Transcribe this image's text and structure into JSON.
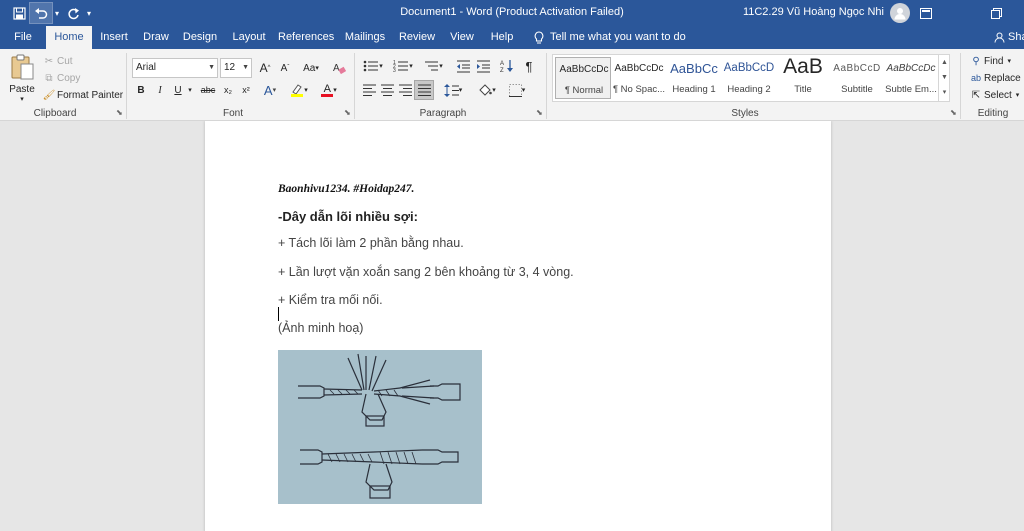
{
  "titlebar": {
    "title": "Document1  -  Word (Product Activation Failed)",
    "account": "11C2.29 Vũ Hoàng Ngọc Nhi"
  },
  "tabs": [
    "File",
    "Home",
    "Insert",
    "Draw",
    "Design",
    "Layout",
    "References",
    "Mailings",
    "Review",
    "View",
    "Help"
  ],
  "active_tab": "Home",
  "tellme": "Tell me what you want to do",
  "share": "Sha",
  "clipboard": {
    "paste": "Paste",
    "cut": "Cut",
    "copy": "Copy",
    "format_painter": "Format Painter",
    "label": "Clipboard"
  },
  "font": {
    "family": "Arial",
    "size": "12",
    "label": "Font",
    "bold": "B",
    "italic": "I",
    "underline": "U",
    "strike": "abc",
    "subscript": "x₂",
    "superscript": "x²",
    "grow": "A",
    "shrink": "A",
    "change_case": "Aa",
    "effects": "A",
    "font_color": "A"
  },
  "paragraph": {
    "label": "Paragraph"
  },
  "styles": {
    "label": "Styles",
    "items": [
      {
        "sample": "AaBbCcDc",
        "name": "¶ Normal"
      },
      {
        "sample": "AaBbCcDc",
        "name": "¶ No Spac..."
      },
      {
        "sample": "AaBbCc",
        "name": "Heading 1"
      },
      {
        "sample": "AaBbCcD",
        "name": "Heading 2"
      },
      {
        "sample": "AaB",
        "name": "Title"
      },
      {
        "sample": "AaBbCcD",
        "name": "Subtitle"
      },
      {
        "sample": "AaBbCcDc",
        "name": "Subtle Em..."
      }
    ]
  },
  "editing": {
    "label": "Editing",
    "find": "Find",
    "replace": "Replace",
    "select": "Select"
  },
  "document": {
    "lines": [
      "Baonhivu1234. #Hoidap247.",
      "-Dây dẫn lõi nhiều sợi:",
      "+ Tách lõi làm 2 phần bằng nhau.",
      "+ Lần lượt vặn xoắn sang 2 bên khoảng từ 3, 4 vòng.",
      "+ Kiểm tra mối nối.",
      "(Ảnh minh hoạ)"
    ]
  },
  "colors": {
    "brand": "#2b579a",
    "ribbon": "#f3f3f3",
    "font_color_red": "#e81123",
    "highlight_yellow": "#ffff00",
    "illustration_bg": "#a7c0cb"
  }
}
